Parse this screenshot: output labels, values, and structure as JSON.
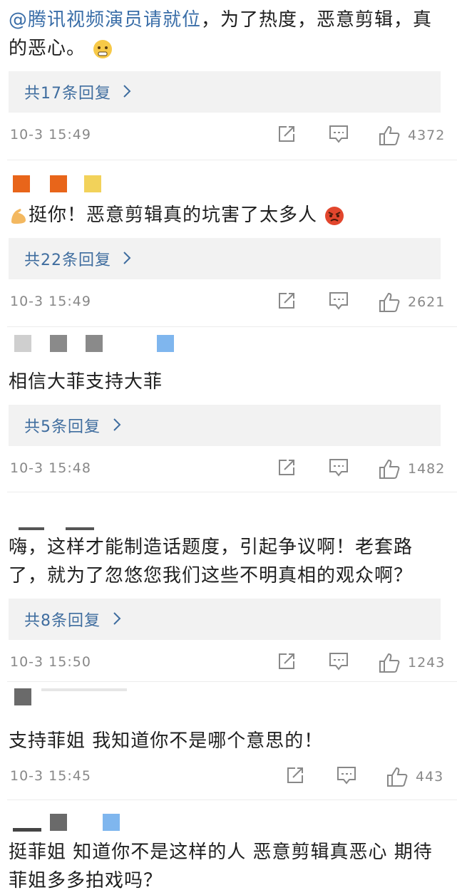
{
  "comments": [
    {
      "mention": "@腾讯视频演员请就位",
      "text": "，为了热度，恶意剪辑，真的恶心。",
      "reply_label": "共17条回复",
      "time": "10-3 15:49",
      "likes": "4372"
    },
    {
      "text": "挺你！恶意剪辑真的坑害了太多人",
      "reply_label": "共22条回复",
      "time": "10-3 15:49",
      "likes": "2621"
    },
    {
      "text": "相信大菲支持大菲",
      "reply_label": "共5条回复",
      "time": "10-3 15:48",
      "likes": "1482"
    },
    {
      "text": "嗨，这样才能制造话题度，引起争议啊！老套路了，就为了忽悠您我们这些不明真相的观众啊？",
      "reply_label": "共8条回复",
      "time": "10-3 15:50",
      "likes": "1243"
    },
    {
      "text": "支持菲姐 我知道你不是哪个意思的！",
      "time": "10-3 15:45",
      "likes": "443"
    },
    {
      "text": "挺菲姐 知道你不是这样的人 恶意剪辑真恶心 期待菲姐多多拍戏吗？"
    }
  ],
  "icons": {
    "share": "share-icon",
    "comment": "comment-icon",
    "like": "thumbs-up-icon",
    "chevron": "chevron-right-icon"
  },
  "colors": {
    "link": "#3f6d9f",
    "reply_bg": "#f2f2f2",
    "meta_text": "#888888",
    "avatar_orange": "#e8651a",
    "avatar_yellow": "#f2d25a",
    "avatar_gray": "#8a8a8a",
    "avatar_blue": "#7fb6ee"
  }
}
